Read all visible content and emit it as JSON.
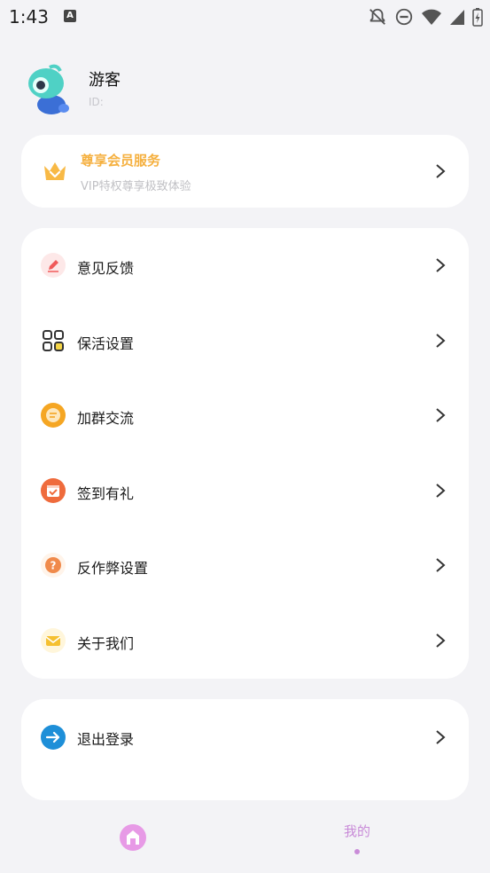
{
  "status_bar": {
    "time": "1:43"
  },
  "profile": {
    "name": "游客",
    "id_label": "ID:"
  },
  "vip": {
    "title": "尊享会员服务",
    "subtitle": "VIP特权尊享极致体验"
  },
  "menu": [
    {
      "label": "意见反馈",
      "icon": "feedback-icon",
      "color": "#f05a5a"
    },
    {
      "label": "保活设置",
      "icon": "grid-icon",
      "color": "#333333"
    },
    {
      "label": "加群交流",
      "icon": "chat-icon",
      "color": "#f5a623"
    },
    {
      "label": "签到有礼",
      "icon": "calendar-icon",
      "color": "#ef6b3c"
    },
    {
      "label": "反作弊设置",
      "icon": "question-icon",
      "color": "#f08a4b"
    },
    {
      "label": "关于我们",
      "icon": "mail-icon",
      "color": "#f5c030"
    }
  ],
  "logout": {
    "label": "退出登录",
    "color": "#1e8fd8"
  },
  "bottom_nav": {
    "mine_label": "我的",
    "accent": "#c98bd8"
  }
}
